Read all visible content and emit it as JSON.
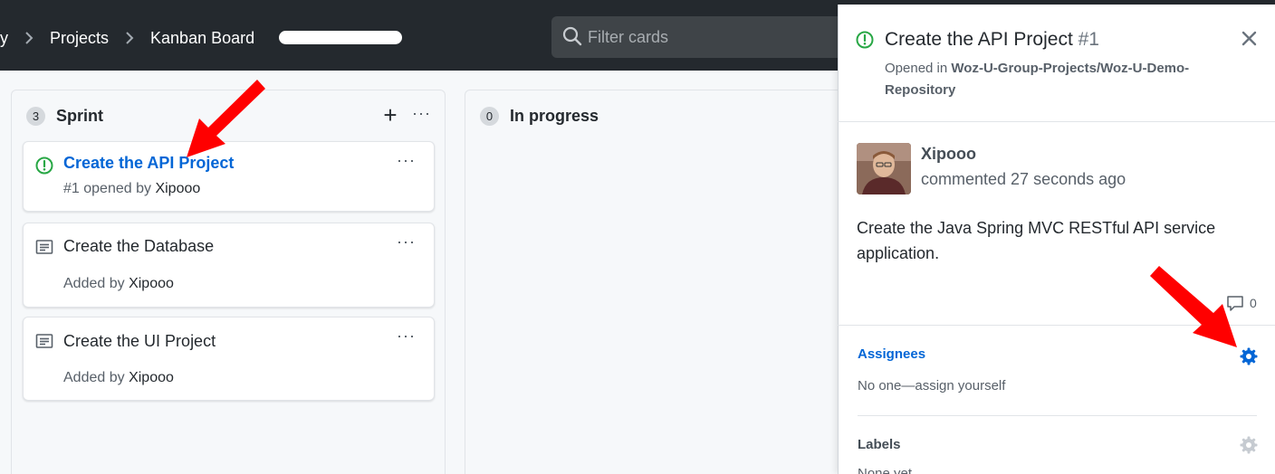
{
  "header": {
    "breadcrumbs": [
      "y",
      "Projects",
      "Kanban Board"
    ],
    "filter_placeholder": "Filter cards"
  },
  "columns": [
    {
      "count": "3",
      "title": "Sprint",
      "add_glyph": "+",
      "more_glyph": "···",
      "cards": [
        {
          "icon": "issue-opened-icon",
          "title": "Create the API Project",
          "meta_prefix": "#1 opened by",
          "meta_user": "Xipooo"
        },
        {
          "icon": "note-icon",
          "title": "Create the Database",
          "meta_prefix": "Added by",
          "meta_user": "Xipooo"
        },
        {
          "icon": "note-icon",
          "title": "Create the UI Project",
          "meta_prefix": "Added by",
          "meta_user": "Xipooo"
        }
      ]
    },
    {
      "count": "0",
      "title": "In progress"
    }
  ],
  "card_more": "···",
  "pane": {
    "title": "Create the API Project",
    "number": "#1",
    "opened_prefix": "Opened in",
    "repo": "Woz-U-Group-Projects/Woz-U-Demo-Repository",
    "author": "Xipooo",
    "comment_time": "commented 27 seconds ago",
    "comment_body": "Create the Java Spring MVC RESTful API service application.",
    "comment_count": "0",
    "assignees_label": "Assignees",
    "assignees_value": "No one—assign yourself",
    "labels_label": "Labels",
    "labels_value": "None yet"
  },
  "colors": {
    "header_bg": "#24292e",
    "link_blue": "#0366d6",
    "open_green": "#28a745",
    "annotation_red": "#ff0000"
  }
}
